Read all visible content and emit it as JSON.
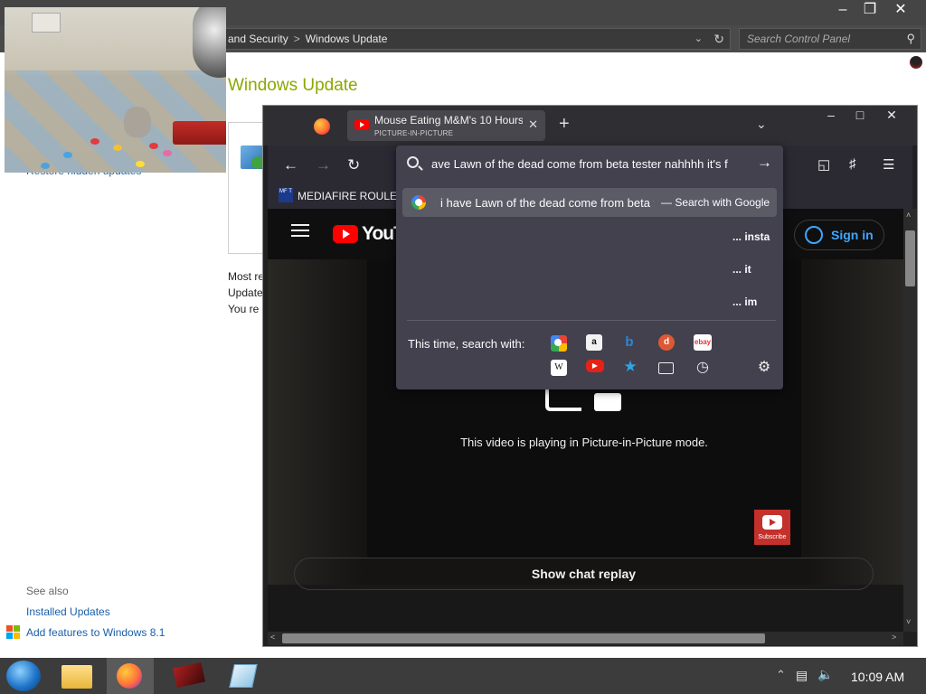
{
  "control_panel": {
    "address_crumbs": [
      "and Security",
      "Windows Update"
    ],
    "address_separator": ">",
    "search_placeholder": "Search Control Panel",
    "heading": "Windows Update",
    "text_lines": [
      "Most re",
      "Update",
      "You re"
    ],
    "hidden_updates_link": "Restore hidden updates",
    "see_also": "See also",
    "installed_updates": "Installed Updates",
    "add_features": "Add features to Windows 8.1"
  },
  "firefox": {
    "tab": {
      "title": "Mouse Eating M&M's 10 Hours",
      "subtitle": "PICTURE-IN-PICTURE"
    },
    "bookmark": {
      "icon_text": "MF T",
      "label": "MEDIAFIRE ROULETT"
    },
    "urlbar": {
      "text": "ave Lawn of the dead come from beta tester nahhhh  it's f",
      "suggestion": "i have Lawn of the dead come from beta tester",
      "suggestion_action": "— Search with Google",
      "rows": [
        "... insta",
        "... it",
        "... im"
      ],
      "oneoff_label": "This time, search with:",
      "oneoff_engines": [
        "google-icon",
        "amazon-icon",
        "bing-icon",
        "duckduckgo-icon",
        "ebay-icon",
        "wikipedia-icon",
        "youtube-icon",
        "bookmarks-icon",
        "tabs-icon",
        "history-icon",
        "settings-icon"
      ]
    },
    "youtube": {
      "logo_text": "YouTube",
      "sign_in": "Sign in",
      "pip_message": "This video is playing in Picture-in-Picture mode.",
      "subscribe": "Subscribe",
      "chat_replay": "Show chat replay"
    }
  },
  "taskbar": {
    "clock": "10:09 AM",
    "apps": [
      "start-orb-icon",
      "file-explorer-icon",
      "firefox-icon",
      "game-app-icon",
      "notepad-icon"
    ]
  },
  "colors": {
    "cp_heading": "#8aa800",
    "link": "#1a5fa8",
    "taskbar": "#3c3c3c",
    "urlbar_panel": "#42414d",
    "youtube_red": "#ff0000",
    "signin_blue": "#3ea6ff"
  }
}
